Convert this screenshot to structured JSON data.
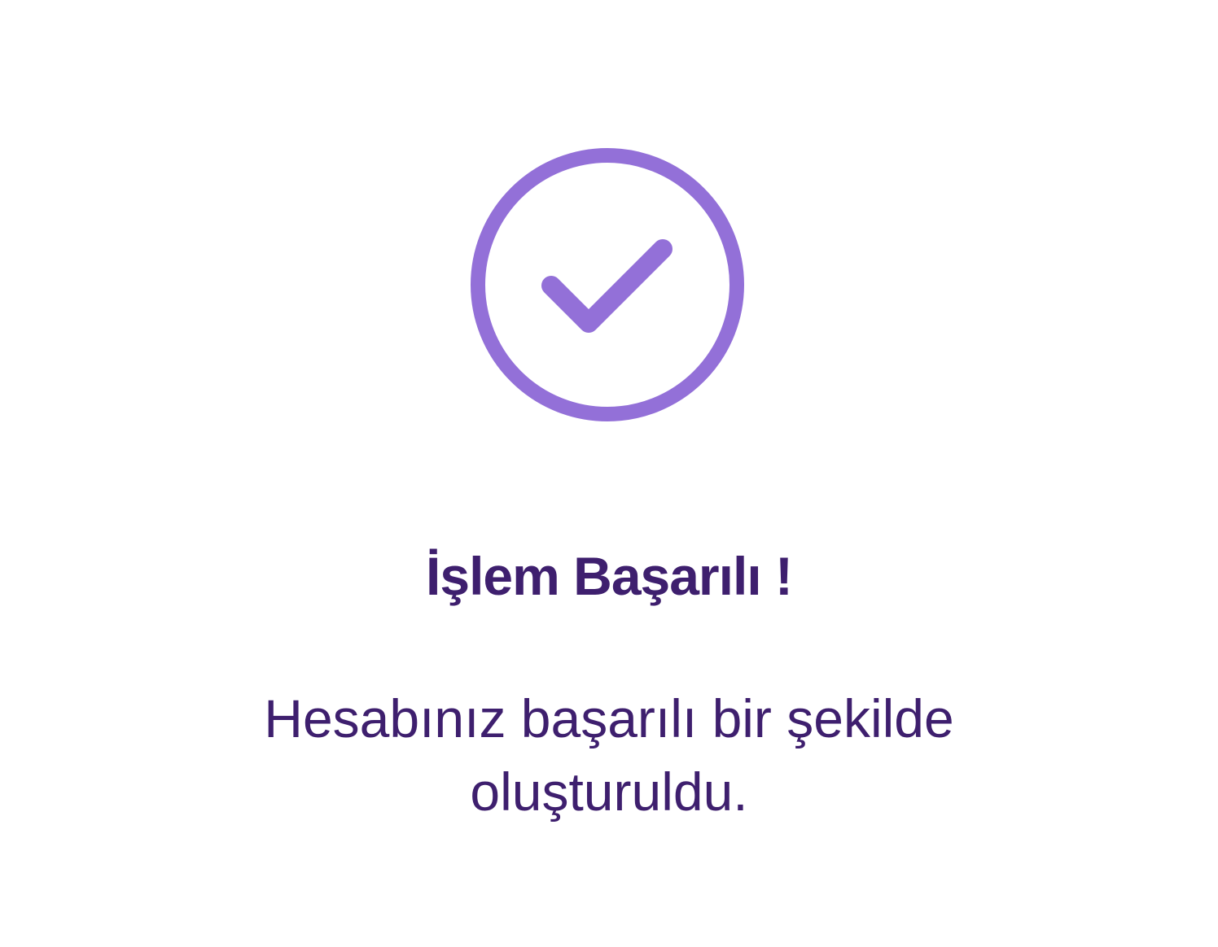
{
  "success_dialog": {
    "icon": "check-circle-icon",
    "accent_color": "#9370d8",
    "text_color": "#3e1f6e",
    "title": "İşlem Başarılı !",
    "message_line_1": "Hesabınız başarılı bir şekilde",
    "message_line_2": "oluşturuldu."
  }
}
